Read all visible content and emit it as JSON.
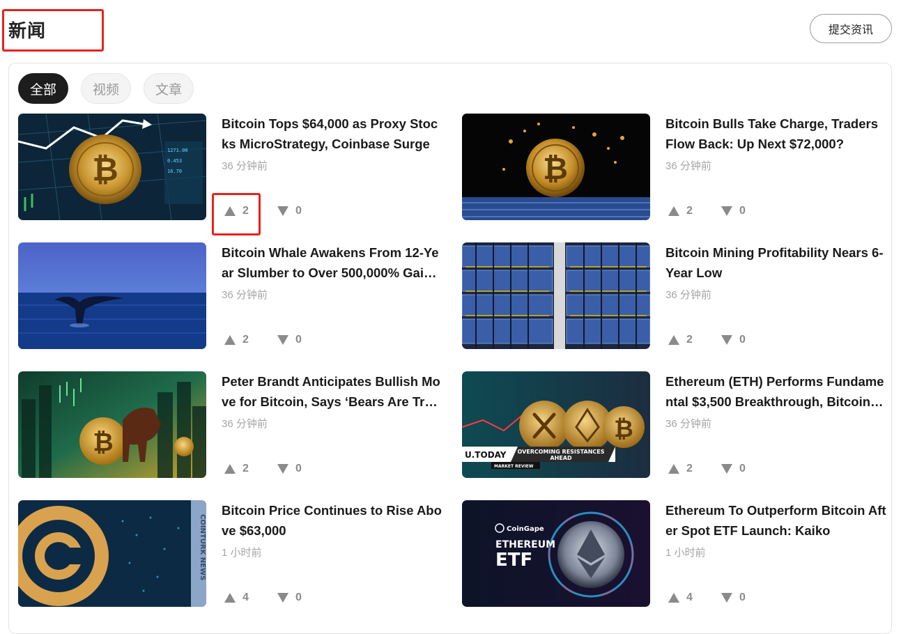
{
  "header": {
    "title": "新闻",
    "submit_label": "提交资讯"
  },
  "tabs": [
    {
      "label": "全部",
      "active": true
    },
    {
      "label": "视频",
      "active": false
    },
    {
      "label": "文章",
      "active": false
    }
  ],
  "icons": {
    "upvote": "triangle-up-icon",
    "downvote": "triangle-down-icon"
  },
  "colors": {
    "highlight": "#e8211b",
    "vote_icon": "#8a8a8a",
    "active_tab": "#1d1d1d"
  },
  "news": [
    {
      "title": "Bitcoin Tops $64,000 as Proxy Stocks MicroStrategy, Coinbase Surge",
      "time": "36 分钟前",
      "up": "2",
      "down": "0",
      "image": "bitcoin-chart-image"
    },
    {
      "title": "Bitcoin Bulls Take Charge, Traders Flow Back: Up Next $72,000?",
      "time": "36 分钟前",
      "up": "2",
      "down": "0",
      "image": "bitcoin-coin-image"
    },
    {
      "title": "Bitcoin Whale Awakens From 12-Year Slumber to Over 500,000% Gains …",
      "time": "36 分钟前",
      "up": "2",
      "down": "0",
      "image": "whale-tail-image"
    },
    {
      "title": "Bitcoin Mining Profitability Nears 6-Year Low",
      "time": "36 分钟前",
      "up": "2",
      "down": "0",
      "image": "mining-rigs-image"
    },
    {
      "title": "Peter Brandt Anticipates Bullish Move for Bitcoin, Says ‘Bears Are Trap…",
      "time": "36 分钟前",
      "up": "2",
      "down": "0",
      "image": "bitcoin-bull-image"
    },
    {
      "title": "Ethereum (ETH) Performs Fundamental $3,500 Breakthrough, Bitcoin (…",
      "time": "36 分钟前",
      "up": "2",
      "down": "0",
      "image": "utoday-coins-image",
      "image_text": {
        "brand": "U.TODAY",
        "headline_1": "OVERCOMING RESISTANCES",
        "headline_2": "AHEAD",
        "tag": "MARKET REVIEW"
      }
    },
    {
      "title": "Bitcoin Price Continues to Rise Above $63,000",
      "time": "1 小时前",
      "up": "4",
      "down": "0",
      "image": "cn-logo-image",
      "image_text": {
        "side": "COINTURK NEWS"
      }
    },
    {
      "title": "Ethereum To Outperform Bitcoin After Spot ETF Launch: Kaiko",
      "time": "1 小时前",
      "up": "4",
      "down": "0",
      "image": "ethereum-etf-image",
      "image_text": {
        "brand": "CoinGape",
        "line1": "ETHEREUM",
        "line2": "ETF"
      }
    }
  ]
}
